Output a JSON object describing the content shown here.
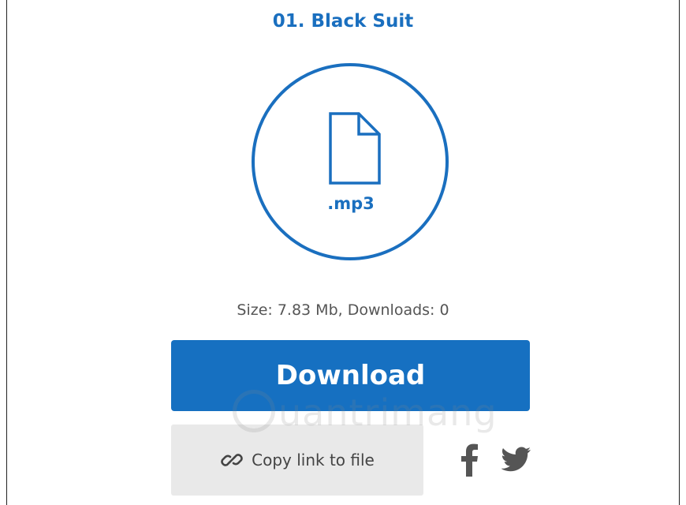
{
  "file": {
    "title": "01. Black Suit",
    "extension": ".mp3",
    "meta": "Size: 7.83 Mb, Downloads: 0"
  },
  "actions": {
    "download_label": "Download",
    "copy_label": "Copy link to file"
  },
  "icons": {
    "file": "file-icon",
    "link": "link-icon",
    "facebook": "facebook-icon",
    "twitter": "twitter-icon"
  },
  "watermark": {
    "text": "uantrimang"
  },
  "colors": {
    "accent": "#1670c1",
    "copy_bg": "#e9e9e9",
    "social": "#555555"
  }
}
